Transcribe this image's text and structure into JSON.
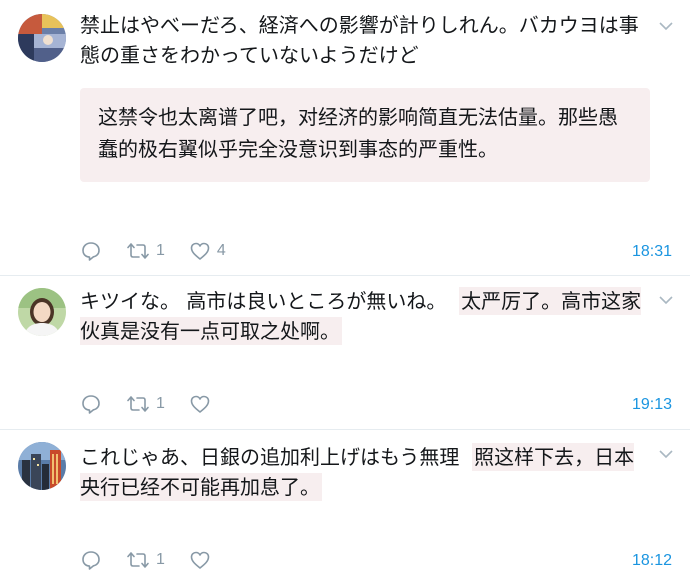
{
  "colors": {
    "text": "#14171a",
    "muted": "#8899a6",
    "timestamp": "#1b95e0",
    "highlight": "#f7eeef",
    "divider": "#e6ecf0"
  },
  "replies": [
    {
      "avatar_icon": "collage-avatar-icon",
      "text": "禁止はやべーだろ、経済への影響が計りしれん。バカウヨは事態の重さをわかっていないようだけど",
      "translation": "这禁令也太离谱了吧，对经济的影响简直无法估量。那些愚蠢的极右翼似乎完全没意识到事态的严重性。",
      "reply_icon": "reply-icon",
      "retweet_icon": "retweet-icon",
      "retweet_count": "1",
      "like_icon": "heart-icon",
      "like_count": "4",
      "time": "18:31"
    },
    {
      "avatar_icon": "woman-portrait-avatar-icon",
      "text": "キツイな。 高市は良いところが無いね。",
      "translation": "太严厉了。高市这家伙真是没有一点可取之处啊。",
      "reply_icon": "reply-icon",
      "retweet_icon": "retweet-icon",
      "retweet_count": "1",
      "like_icon": "heart-icon",
      "like_count": "",
      "time": "19:13"
    },
    {
      "avatar_icon": "city-night-avatar-icon",
      "text": "これじゃあ、日銀の追加利上げはもう無理",
      "translation": "照这样下去，日本央行已经不可能再加息了。",
      "reply_icon": "reply-icon",
      "retweet_icon": "retweet-icon",
      "retweet_count": "1",
      "like_icon": "heart-icon",
      "like_count": "",
      "time": "18:12"
    }
  ]
}
